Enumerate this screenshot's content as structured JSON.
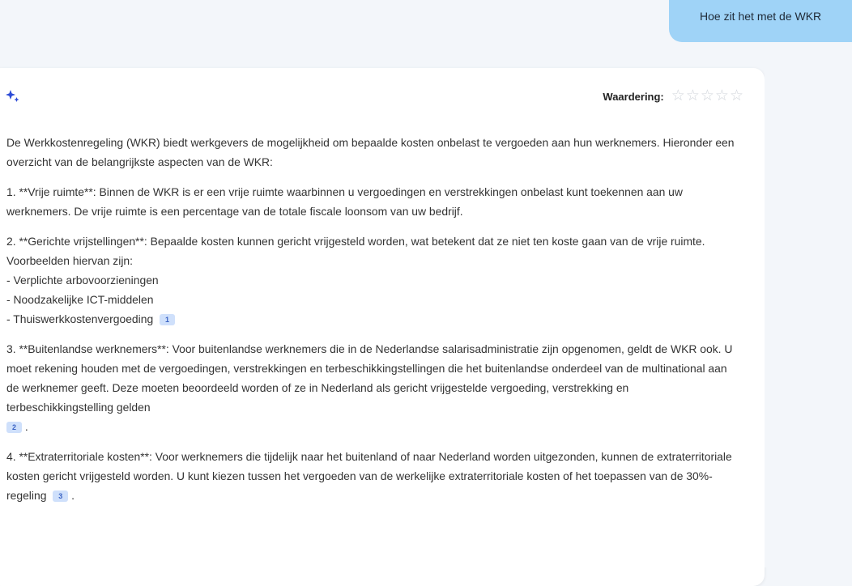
{
  "user_message": {
    "text": "Hoe zit het met de WKR"
  },
  "answer": {
    "rating_label": "Waardering:",
    "stars": [
      "☆",
      "☆",
      "☆",
      "☆",
      "☆"
    ],
    "icon": "sparkle-icon",
    "intro": "De Werkkostenregeling (WKR) biedt werkgevers de mogelijkheid om bepaalde kosten onbelast te vergoeden aan hun werknemers. Hieronder een overzicht van de belangrijkste aspecten van de WKR:",
    "point1": "1. **Vrije ruimte**: Binnen de WKR is er een vrije ruimte waarbinnen u vergoedingen en verstrekkingen onbelast kunt toekennen aan uw werknemers. De vrije ruimte is een percentage van de totale fiscale loonsom van uw bedrijf.",
    "point2_heading": "2. **Gerichte vrijstellingen**: Bepaalde kosten kunnen gericht vrijgesteld worden, wat betekent dat ze niet ten koste gaan van de vrije ruimte. Voorbeelden hiervan zijn:",
    "point2_items": [
      "- Verplichte arbovoorzieningen",
      "- Noodzakelijke ICT-middelen",
      "- Thuiswerkkostenvergoeding"
    ],
    "point3": "3. **Buitenlandse werknemers**: Voor buitenlandse werknemers die in de Nederlandse salarisadministratie zijn opgenomen, geldt de WKR ook. U moet rekening houden met de vergoedingen, verstrekkingen en terbeschikkingstellingen die het buitenlandse onderdeel van de multinational aan de werknemer geeft. Deze moeten beoordeeld worden of ze in Nederland als gericht vrijgestelde vergoeding, verstrekking en terbeschikkingstelling gelden",
    "point4": "4. **Extraterritoriale kosten**: Voor werknemers die tijdelijk naar het buitenland of naar Nederland worden uitgezonden, kunnen de extraterritoriale kosten gericht vrijgesteld worden. U kunt kiezen tussen het vergoeden van de werkelijke extraterritoriale kosten of het toepassen van de 30%-regeling",
    "period": ".",
    "citations": [
      "1",
      "2",
      "3"
    ]
  },
  "colors": {
    "user_bubble": "#9fd3f7",
    "citation_bg": "#cfe0fb",
    "citation_text": "#3b63c4",
    "sparkle": "#2c4bd6"
  }
}
